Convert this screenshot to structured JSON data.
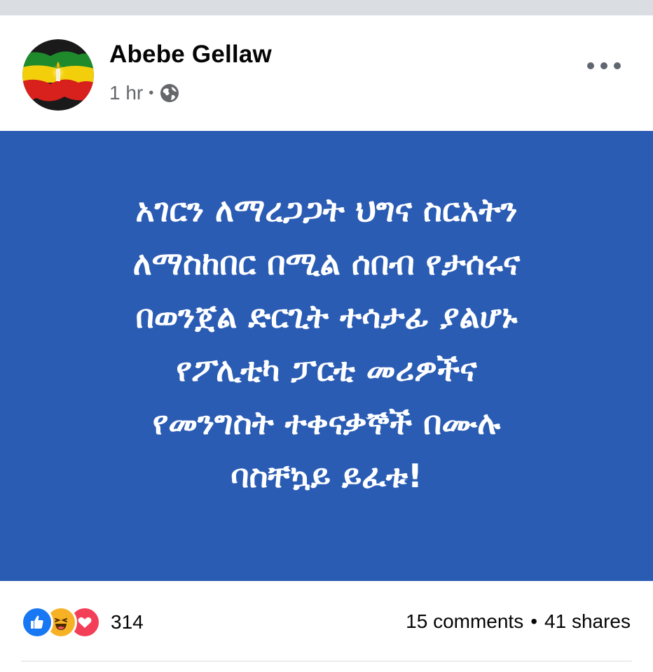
{
  "post": {
    "author": "Abebe Gellaw",
    "timestamp": "1 hr",
    "separator": "•",
    "privacy_icon": "globe-icon",
    "text": "አገርን ለማረጋጋት ህግና  ስርአትን\nለማስከበር በሚል ሰበብ የታሰሩና\nበወንጀል ድርጊት ተሳታፊ ያልሆኑ\nየፖሊቲካ ፓርቲ መሪዎችና\nየመንግስት ተቀናቃኞች በሙሉ\nባስቸኳይ ይፈቱ!",
    "background_color": "#2a5cb4",
    "text_color": "#ffffff"
  },
  "engagement": {
    "reaction_icons": [
      "like-icon",
      "haha-icon",
      "love-icon"
    ],
    "reaction_count": "314",
    "comments": "15 comments",
    "dot": "•",
    "shares": "41 shares"
  },
  "colors": {
    "like": "#1877f2",
    "haha": "#f7b125",
    "love": "#f33e58",
    "muted": "#65676b"
  }
}
